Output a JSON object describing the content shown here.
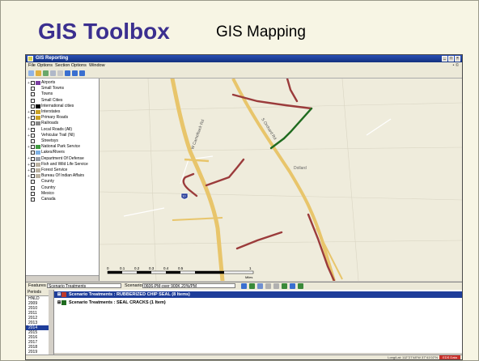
{
  "slide": {
    "title": "GIS Toolbox",
    "subtitle": "GIS Mapping"
  },
  "app": {
    "window_title": "GIS Reporting",
    "menu": [
      "File",
      "Options",
      "Section Options",
      "Window"
    ],
    "menu_right": "• ©",
    "layers": [
      {
        "label": "Airports",
        "expand": "+",
        "swatch": "#7a3da0"
      },
      {
        "label": "Small Towns",
        "expand": "",
        "swatch": ""
      },
      {
        "label": "Towns",
        "expand": "",
        "swatch": ""
      },
      {
        "label": "Small Cities",
        "expand": "",
        "swatch": ""
      },
      {
        "label": "International cities",
        "expand": "",
        "swatch": "#000000"
      },
      {
        "label": "Interstates",
        "expand": "+",
        "swatch": "#c9a227"
      },
      {
        "label": "Primary Roads",
        "expand": "+",
        "swatch": "#c9a227"
      },
      {
        "label": "Railroads",
        "expand": "",
        "swatch": "#888888"
      },
      {
        "label": "Local Roads (All)",
        "expand": "+",
        "swatch": ""
      },
      {
        "label": "Vehicular Trail (NI)",
        "expand": "+",
        "swatch": ""
      },
      {
        "label": "Streetsys",
        "expand": "",
        "swatch": ""
      },
      {
        "label": "National Park Service",
        "expand": "+",
        "swatch": "#3f9a3f"
      },
      {
        "label": "Lakes/Rivers",
        "expand": "",
        "swatch": "#7fb2e5"
      },
      {
        "label": "Department Of Defense",
        "expand": "+",
        "swatch": "#9aa0a8"
      },
      {
        "label": "Fish and Wild Life Service",
        "expand": "+",
        "swatch": "#bcb3a2"
      },
      {
        "label": "Forest Service",
        "expand": "+",
        "swatch": "#bcb3a2"
      },
      {
        "label": "Bureau Of Indian Affairs",
        "expand": "+",
        "swatch": "#bcb3a2"
      },
      {
        "label": "County",
        "expand": "",
        "swatch": ""
      },
      {
        "label": "Country",
        "expand": "",
        "swatch": ""
      },
      {
        "label": "Mexico",
        "expand": "",
        "swatch": ""
      },
      {
        "label": "Canada",
        "expand": "",
        "swatch": ""
      }
    ],
    "map": {
      "road_label_1": "W Camelback Rd",
      "road_label_2": "S Orchard Rd",
      "place_label": "Dollard",
      "interstate_shield": "10",
      "scale_labels": [
        "0",
        "0.1",
        "0.2",
        "0.3",
        "0.4",
        "0.5",
        "1"
      ],
      "scale_unit": "Miles"
    },
    "features_bar": {
      "features_label": "Features",
      "features_value": "Scenario Treatments",
      "scenario_label": "Scenario",
      "scenario_value": "0606-PM-over 900K 20%/PM"
    },
    "periods": {
      "header": "Periods",
      "items": [
        "HNLD",
        "2009",
        "2010",
        "2011",
        "2012",
        "2013",
        "2014",
        "2015",
        "2016",
        "2017",
        "2018",
        "2019"
      ],
      "selected": "2014"
    },
    "grid_rows": [
      {
        "text": "Scenario Treatments : RUBBERIZED CHIP SEAL (8 Items)",
        "color": "#c0392b",
        "expand": "⊞",
        "selected": true
      },
      {
        "text": "Scenario Treatments : SEAL CRACKS (1 Item)",
        "color": "#1f6b1f",
        "expand": "⊞",
        "selected": false
      }
    ],
    "status": {
      "coords": "Long/Lat: 112°27'48\"W  37°41'02\"N",
      "badge": "EDS Data"
    }
  },
  "colors": {
    "title": "#3b2f8f",
    "road_major": "#e8c56b",
    "treatment_red": "#9b3b3b",
    "treatment_green": "#1f6b1f",
    "selection_blue": "#1e3d9a"
  }
}
